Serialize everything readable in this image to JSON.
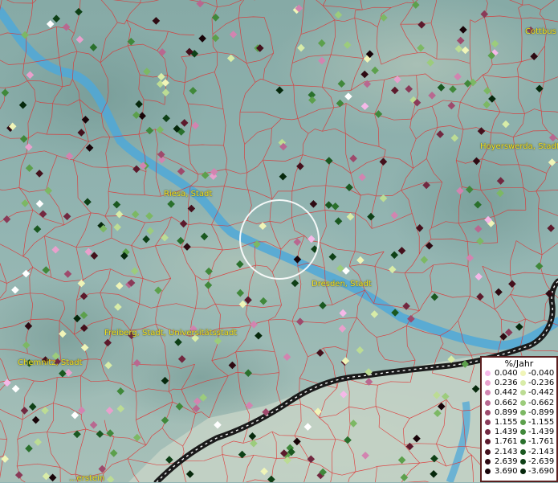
{
  "map": {
    "cities": [
      {
        "id": "cottbus",
        "label": "Cottbus"
      },
      {
        "id": "hoyerswerda",
        "label": "Hoyerswerda, Stadt"
      },
      {
        "id": "riesa",
        "label": "Riesa, Stadt"
      },
      {
        "id": "dresden",
        "label": "Dresden, Stadt"
      },
      {
        "id": "freiberg",
        "label": "Freiberg, Stadt, Universitätsstadt"
      },
      {
        "id": "chemnitz",
        "label": "Chemnitz, Stadt"
      },
      {
        "id": "bottom",
        "label": "...erstein"
      }
    ],
    "colors": {
      "river": "#4fa8d8",
      "boundary": "#e03030",
      "border": "#1a1a1a",
      "label": "#f2e020"
    }
  },
  "legend": {
    "title": "%/Jahr",
    "positive": [
      {
        "value": "0.040",
        "color": "#f5b8e8"
      },
      {
        "value": "0.236",
        "color": "#e8a0cc"
      },
      {
        "value": "0.442",
        "color": "#d284b0"
      },
      {
        "value": "0.662",
        "color": "#b86890"
      },
      {
        "value": "0.899",
        "color": "#9e4a6c"
      },
      {
        "value": "1.155",
        "color": "#8a3a58"
      },
      {
        "value": "1.439",
        "color": "#722840"
      },
      {
        "value": "1.761",
        "color": "#5c1a2c"
      },
      {
        "value": "2.143",
        "color": "#44101c"
      },
      {
        "value": "2.639",
        "color": "#2e0a12"
      },
      {
        "value": "3.690",
        "color": "#180408"
      }
    ],
    "negative": [
      {
        "value": "-0.040",
        "color": "#f0f5b8"
      },
      {
        "value": "-0.236",
        "color": "#d8eca8"
      },
      {
        "value": "-0.442",
        "color": "#bcdc94"
      },
      {
        "value": "-0.662",
        "color": "#9ccc7c"
      },
      {
        "value": "-0.899",
        "color": "#7cb864"
      },
      {
        "value": "-1.155",
        "color": "#5ca04c"
      },
      {
        "value": "-1.439",
        "color": "#40883a"
      },
      {
        "value": "-1.761",
        "color": "#2a702c"
      },
      {
        "value": "-2.143",
        "color": "#1a5820"
      },
      {
        "value": "-2.639",
        "color": "#0e4016"
      },
      {
        "value": "-3.690",
        "color": "#06280c"
      }
    ]
  }
}
